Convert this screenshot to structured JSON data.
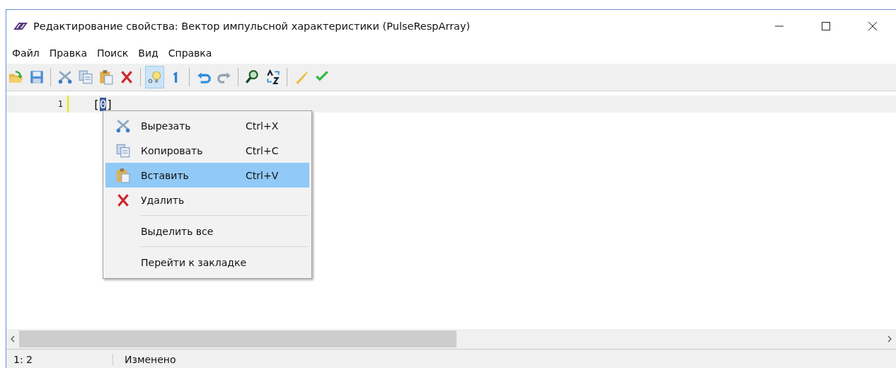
{
  "window": {
    "title": "Редактирование свойства: Вектор импульсной характеристики (PulseRespArray)"
  },
  "menu_bar": [
    "Файл",
    "Правка",
    "Поиск",
    "Вид",
    "Справка"
  ],
  "toolbar": [
    [
      {
        "pressed": false
      },
      {
        "pressed": false
      }
    ],
    [
      {
        "pressed": false
      },
      {
        "pressed": false
      },
      {
        "pressed": false
      },
      {
        "pressed": false
      }
    ],
    [
      {
        "pressed": true
      },
      {
        "pressed": false
      }
    ],
    [
      {
        "pressed": false
      },
      {
        "pressed": false
      }
    ],
    [
      {
        "pressed": false
      },
      {
        "pressed": false
      }
    ],
    [
      {
        "pressed": false
      },
      {
        "pressed": false
      }
    ]
  ],
  "editor": {
    "lines": [
      {
        "number": "1",
        "current": true,
        "modified": true,
        "before": "[",
        "selection": "0",
        "after": "]"
      }
    ]
  },
  "context_menu": {
    "sections": [
      [
        {
          "label": "Вырезать",
          "shortcut": "Ctrl+X",
          "selected": false
        },
        {
          "label": "Копировать",
          "shortcut": "Ctrl+C",
          "selected": false
        },
        {
          "label": "Вставить",
          "shortcut": "Ctrl+V",
          "selected": true
        },
        {
          "label": "Удалить",
          "selected": false
        }
      ],
      [
        {
          "label": "Выделить все",
          "selected": false
        }
      ],
      [
        {
          "label": "Перейти к закладке",
          "selected": false
        }
      ]
    ]
  },
  "status_bar": {
    "position": "1: 2",
    "state": "Изменено"
  }
}
